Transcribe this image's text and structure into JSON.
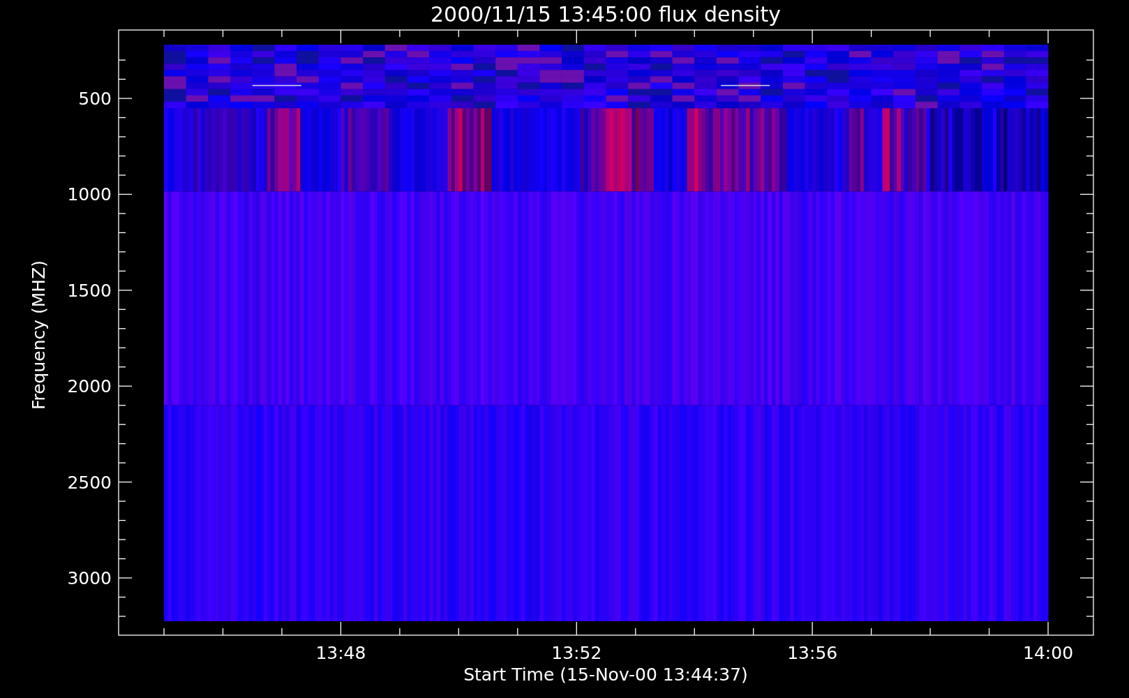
{
  "plot": {
    "title": "2000/11/15 13:45:00 flux density",
    "x_axis": {
      "label": "Start Time (15-Nov-00 13:44:37)",
      "ticks": [
        "13:48",
        "13:52",
        "13:56",
        "14:00"
      ]
    },
    "y_axis": {
      "label": "Frequency (MHZ)",
      "ticks": [
        "500",
        "1000",
        "1500",
        "2000",
        "2500",
        "3000"
      ]
    }
  }
}
